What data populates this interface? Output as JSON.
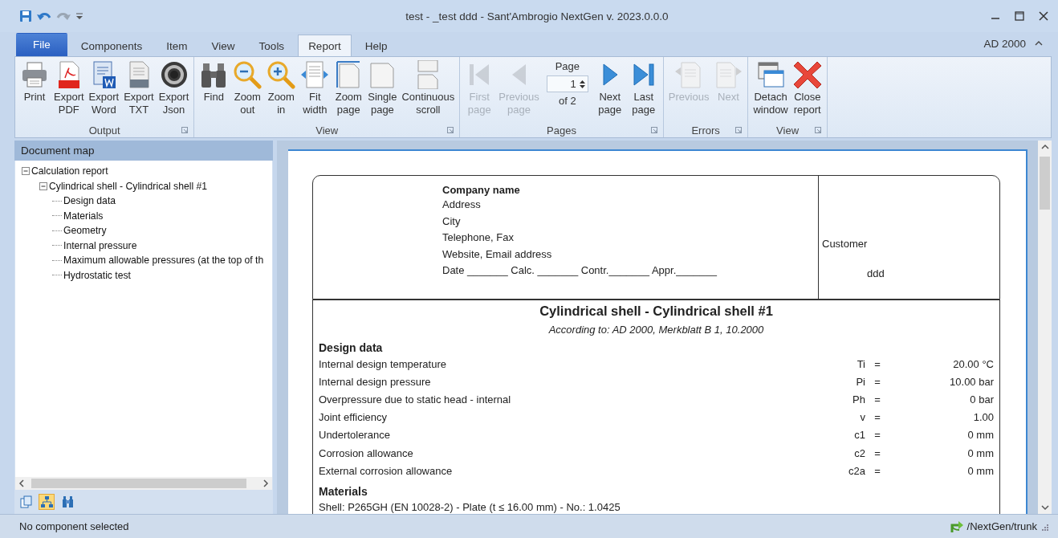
{
  "window": {
    "title": "test - _test ddd - Sant'Ambrogio NextGen v. 2023.0.0.0"
  },
  "tabs": [
    {
      "label": "File",
      "kind": "file",
      "selected": false
    },
    {
      "label": "Components",
      "kind": "tab",
      "selected": false
    },
    {
      "label": "Item",
      "kind": "tab",
      "selected": false
    },
    {
      "label": "View",
      "kind": "tab",
      "selected": false
    },
    {
      "label": "Tools",
      "kind": "tab",
      "selected": false
    },
    {
      "label": "Report",
      "kind": "tab",
      "selected": true
    },
    {
      "label": "Help",
      "kind": "tab",
      "selected": false
    }
  ],
  "standard": {
    "label": "AD 2000"
  },
  "ribbon_groups": [
    {
      "caption": "Output",
      "items": [
        {
          "kind": "button",
          "label": "Print",
          "disabled": false
        },
        {
          "kind": "button",
          "label": "Export\nPDF",
          "disabled": false
        },
        {
          "kind": "button",
          "label": "Export\nWord",
          "disabled": false
        },
        {
          "kind": "button",
          "label": "Export\nTXT",
          "disabled": false
        },
        {
          "kind": "button",
          "label": "Export\nJson",
          "disabled": false
        }
      ]
    },
    {
      "caption": "View",
      "items": [
        {
          "kind": "button",
          "label": "Find",
          "disabled": false
        },
        {
          "kind": "button",
          "label": "Zoom\nout",
          "disabled": false
        },
        {
          "kind": "button",
          "label": "Zoom\nin",
          "disabled": false
        },
        {
          "kind": "button",
          "label": "Fit\nwidth",
          "disabled": false
        },
        {
          "kind": "button",
          "label": "Zoom\npage",
          "disabled": false
        },
        {
          "kind": "button",
          "label": "Single\npage",
          "disabled": false
        },
        {
          "kind": "button",
          "label": "Continuous\nscroll",
          "disabled": false
        }
      ]
    },
    {
      "caption": "Pages",
      "items": [
        {
          "kind": "button",
          "label": "First\npage",
          "disabled": true
        },
        {
          "kind": "button",
          "label": "Previous\npage",
          "disabled": true
        },
        {
          "kind": "spinner",
          "label": "Page",
          "value": "1",
          "caption": "of 2"
        },
        {
          "kind": "button",
          "label": "Next\npage",
          "disabled": false
        },
        {
          "kind": "button",
          "label": "Last\npage",
          "disabled": false
        }
      ]
    },
    {
      "caption": "Errors",
      "items": [
        {
          "kind": "button",
          "label": "Previous",
          "disabled": true
        },
        {
          "kind": "button",
          "label": "Next",
          "disabled": true
        }
      ]
    },
    {
      "caption": "View",
      "items": [
        {
          "kind": "button",
          "label": "Detach\nwindow",
          "disabled": false
        },
        {
          "kind": "button",
          "label": "Close\nreport",
          "disabled": false
        }
      ]
    }
  ],
  "document_map": {
    "title": "Document map",
    "tree": [
      {
        "label": "Calculation report",
        "expanded": true,
        "children": [
          {
            "label": "Cylindrical shell - Cylindrical shell #1",
            "expanded": true,
            "children": [
              {
                "label": "Design data"
              },
              {
                "label": "Materials"
              },
              {
                "label": "Geometry"
              },
              {
                "label": "Internal pressure"
              },
              {
                "label": "Maximum allowable pressures (at the top of th"
              },
              {
                "label": "Hydrostatic test"
              }
            ]
          }
        ]
      }
    ],
    "pane_tabs": [
      {
        "selected": false
      },
      {
        "selected": true
      },
      {
        "selected": false
      }
    ]
  },
  "report": {
    "header": {
      "company_name": "Company name",
      "lines": [
        "Address",
        "City",
        "Telephone, Fax",
        "Website, Email address",
        "Date _______ Calc. _______ Contr._______ Appr._______"
      ],
      "customer_label": "Customer",
      "customer": "ddd"
    },
    "title": "Cylindrical shell - Cylindrical shell #1",
    "subtitle": "According to: AD 2000, Merkblatt B 1, 10.2000",
    "sections": [
      {
        "title": "Design data",
        "rows": [
          {
            "label": "Internal design temperature",
            "symbol": "Ti",
            "sign": "=",
            "value": "20.00 °C"
          },
          {
            "label": "Internal design pressure",
            "symbol": "Pi",
            "sign": "=",
            "value": "10.00 bar"
          },
          {
            "label": "Overpressure due to static head - internal",
            "symbol": "Ph",
            "sign": "=",
            "value": "0 bar"
          },
          {
            "label": "Joint efficiency",
            "symbol": "v",
            "sign": "=",
            "value": "1.00"
          },
          {
            "label": "Undertolerance",
            "symbol": "c1",
            "sign": "=",
            "value": "0 mm"
          },
          {
            "label": "Corrosion allowance",
            "symbol": "c2",
            "sign": "=",
            "value": "0 mm"
          },
          {
            "label": "External corrosion allowance",
            "symbol": "c2a",
            "sign": "=",
            "value": "0 mm"
          }
        ]
      },
      {
        "title": "Materials",
        "lines": [
          "Shell: P265GH (EN 10028-2) - Plate (t ≤ 16.00 mm) - No.: 1.0425"
        ]
      }
    ]
  },
  "status_bar": {
    "message": "No component selected",
    "branch": "/NextGen/trunk"
  }
}
